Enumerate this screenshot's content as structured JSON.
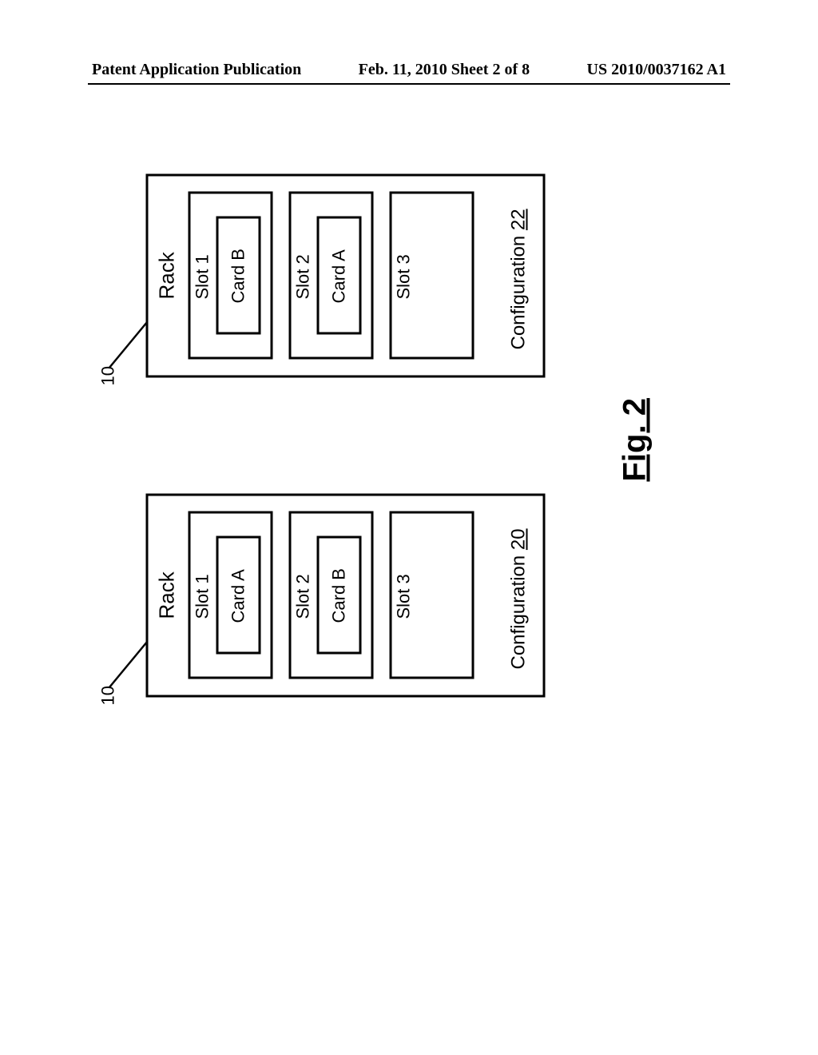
{
  "header": {
    "left": "Patent Application Publication",
    "center": "Feb. 11, 2010  Sheet 2 of 8",
    "right": "US 2010/0037162 A1"
  },
  "figure": {
    "ref_left": "10",
    "ref_right": "10",
    "rack_title_left": "Rack",
    "rack_title_right": "Rack",
    "left": {
      "slot1": "Slot 1",
      "slot1_card": "Card A",
      "slot2": "Slot 2",
      "slot2_card": "Card B",
      "slot3": "Slot 3",
      "config_word": "Configuration ",
      "config_num": "20"
    },
    "right": {
      "slot1": "Slot 1",
      "slot1_card": "Card B",
      "slot2": "Slot 2",
      "slot2_card": "Card A",
      "slot3": "Slot 3",
      "config_word": "Configuration ",
      "config_num": "22"
    },
    "caption": "Fig. 2"
  }
}
